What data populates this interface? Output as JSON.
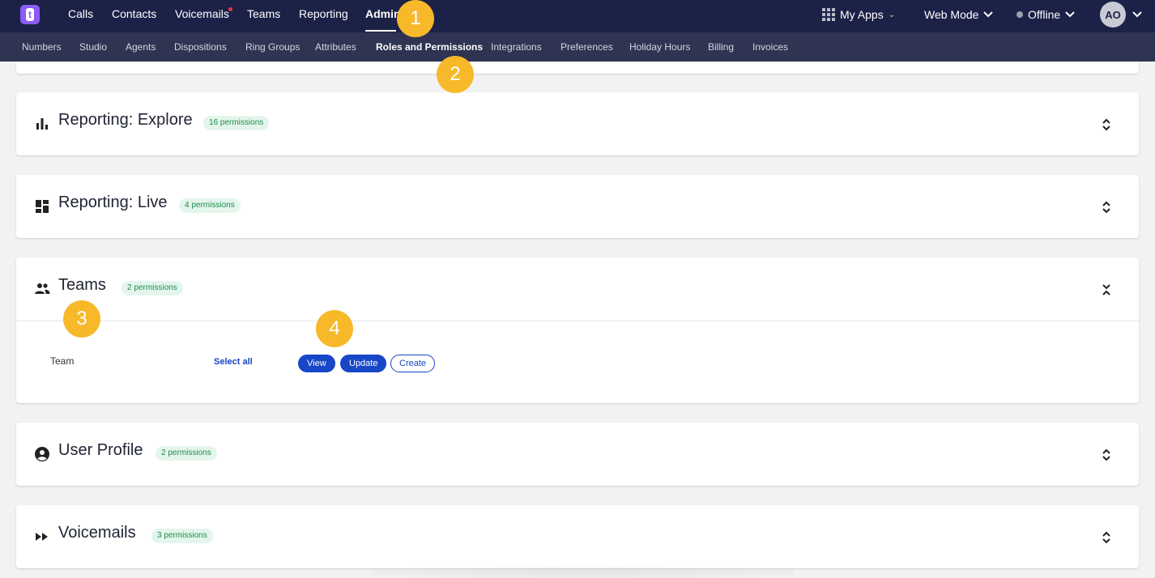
{
  "app": {
    "logo_text": "t"
  },
  "top_nav": {
    "items": [
      "Calls",
      "Contacts",
      "Voicemails",
      "Teams",
      "Reporting",
      "Admin"
    ],
    "active": "Admin",
    "right": {
      "my_apps": "My Apps",
      "mode": "Web Mode",
      "status": "Offline",
      "avatar": "AO"
    }
  },
  "sub_nav": {
    "items": [
      "Numbers",
      "Studio",
      "Agents",
      "Dispositions",
      "Ring Groups",
      "Attributes",
      "Roles and Permissions",
      "Integrations",
      "Preferences",
      "Holiday Hours",
      "Billing",
      "Invoices"
    ],
    "active": "Roles and Permissions"
  },
  "sections": [
    {
      "title": "Reporting: Explore",
      "badge": "16 permissions",
      "icon": "bar-chart-icon",
      "expanded": false
    },
    {
      "title": "Reporting: Live",
      "badge": "4 permissions",
      "icon": "dashboard-icon",
      "expanded": false
    },
    {
      "title": "Teams",
      "badge": "2 permissions",
      "icon": "people-icon",
      "expanded": true,
      "rows": [
        {
          "label": "Team",
          "select_all": "Select all",
          "buttons": [
            {
              "label": "View",
              "on": true
            },
            {
              "label": "Update",
              "on": true
            },
            {
              "label": "Create",
              "on": false
            }
          ]
        }
      ]
    },
    {
      "title": "User Profile",
      "badge": "2 permissions",
      "icon": "account-circle-icon",
      "expanded": false
    },
    {
      "title": "Voicemails",
      "badge": "3 permissions",
      "icon": "fast-forward-icon",
      "expanded": false
    }
  ],
  "markers": [
    "1",
    "2",
    "3",
    "4"
  ],
  "colors": {
    "nav": "#1c2147",
    "subnav": "#2e3451",
    "accent": "#1746c7",
    "marker": "#f7b92a",
    "badge_bg": "#e4f6ec",
    "badge_text": "#1f8a4c"
  }
}
